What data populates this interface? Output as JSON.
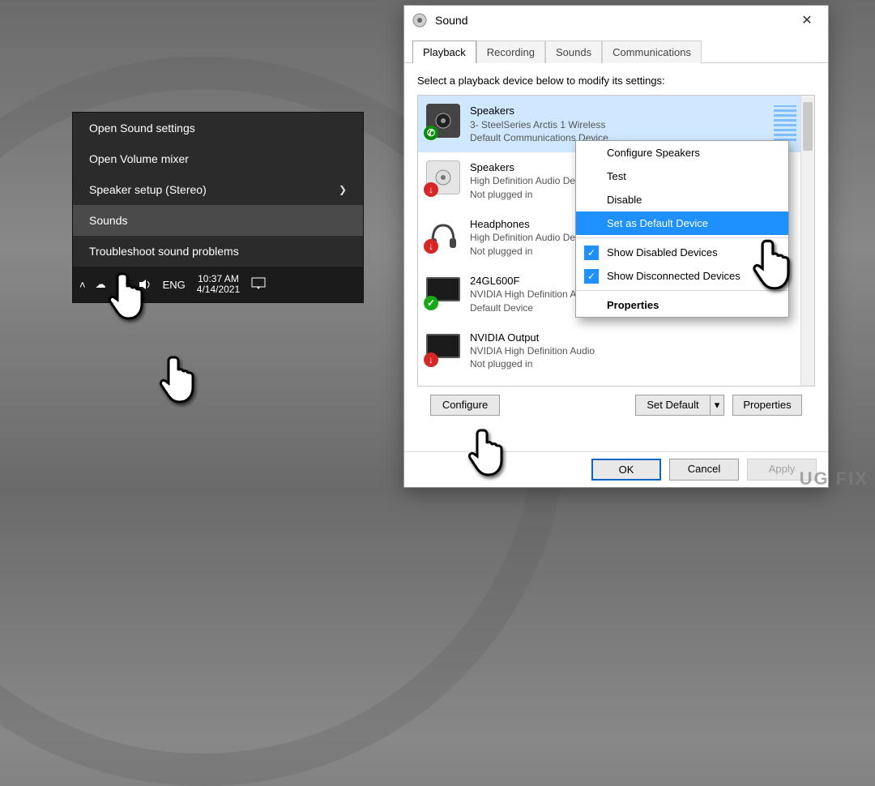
{
  "darkMenu": {
    "items": [
      {
        "label": "Open Sound settings"
      },
      {
        "label": "Open Volume mixer"
      },
      {
        "label": "Speaker setup (Stereo)",
        "chevron": true
      },
      {
        "label": "Sounds"
      },
      {
        "label": "Troubleshoot sound problems"
      }
    ]
  },
  "taskbar": {
    "lang": "ENG",
    "time": "10:37 AM",
    "date": "4/14/2021"
  },
  "soundDialog": {
    "title": "Sound",
    "tabs": [
      "Playback",
      "Recording",
      "Sounds",
      "Communications"
    ],
    "activeTab": 0,
    "prompt": "Select a playback device below to modify its settings:",
    "devices": [
      {
        "name": "Speakers",
        "sub1": "3- SteelSeries Arctis 1 Wireless",
        "sub2": "Default Communications Device",
        "badge": "phone",
        "selected": true,
        "meter": true,
        "icon": "speaker-dark"
      },
      {
        "name": "Speakers",
        "sub1": "High Definition Audio Device",
        "sub2": "Not plugged in",
        "badge": "red",
        "icon": "speaker-light"
      },
      {
        "name": "Headphones",
        "sub1": "High Definition Audio Device",
        "sub2": "Not plugged in",
        "badge": "red",
        "icon": "headphones"
      },
      {
        "name": "24GL600F",
        "sub1": "NVIDIA High Definition Audio",
        "sub2": "Default Device",
        "badge": "green",
        "icon": "monitor"
      },
      {
        "name": "NVIDIA Output",
        "sub1": "NVIDIA High Definition Audio",
        "sub2": "Not plugged in",
        "badge": "red",
        "icon": "monitor"
      }
    ],
    "buttons": {
      "configure": "Configure",
      "setDefault": "Set Default",
      "properties": "Properties",
      "ok": "OK",
      "cancel": "Cancel",
      "apply": "Apply"
    }
  },
  "contextMenu": {
    "items": [
      {
        "label": "Configure Speakers"
      },
      {
        "label": "Test"
      },
      {
        "label": "Disable"
      },
      {
        "label": "Set as Default Device",
        "highlight": true
      },
      {
        "sep": true
      },
      {
        "label": "Show Disabled Devices",
        "check": true
      },
      {
        "label": "Show Disconnected Devices",
        "check": true
      },
      {
        "sep": true
      },
      {
        "label": "Properties",
        "bold": true
      }
    ]
  },
  "watermark": "UG   FIX"
}
